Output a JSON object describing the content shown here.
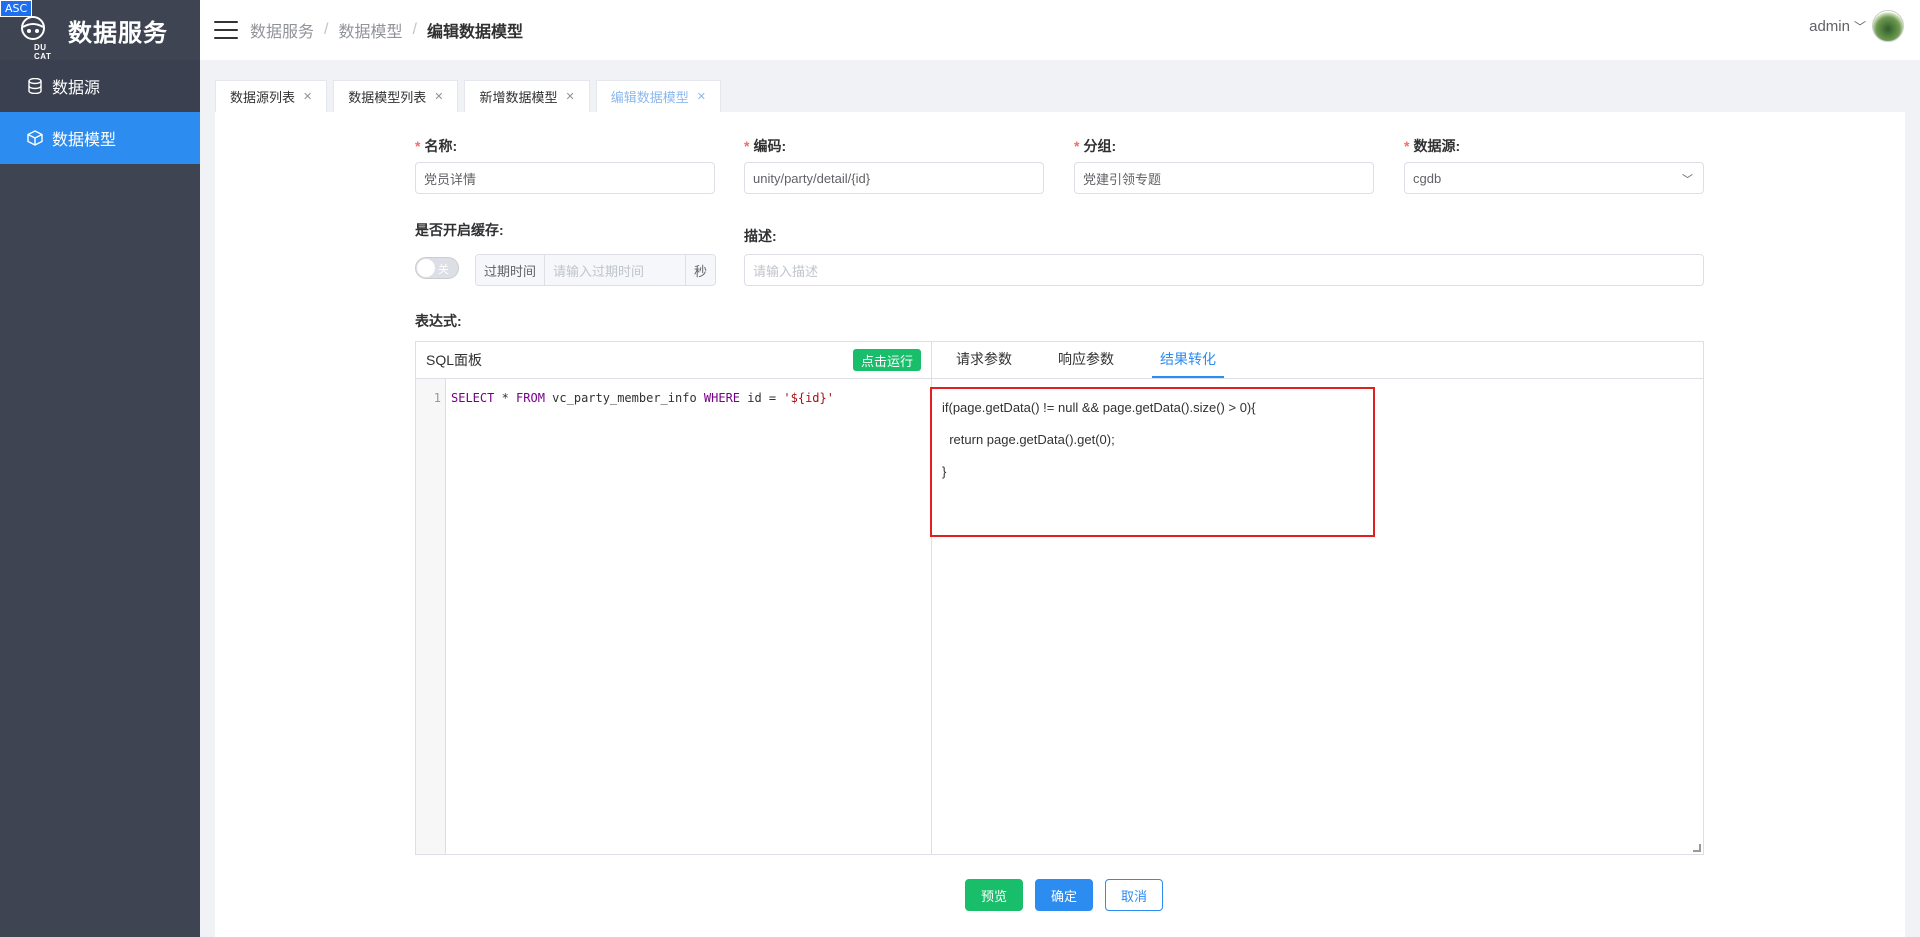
{
  "brand": {
    "badge": "ASC",
    "logo_sub": "DU CAT",
    "title": "数据服务"
  },
  "sidebar": {
    "items": [
      {
        "label": "数据源",
        "icon": "database-icon",
        "active": false
      },
      {
        "label": "数据模型",
        "icon": "cube-icon",
        "active": true
      }
    ]
  },
  "header": {
    "breadcrumb": [
      "数据服务",
      "数据模型",
      "编辑数据模型"
    ],
    "user": "admin"
  },
  "tabs": [
    {
      "label": "数据源列表",
      "active": false
    },
    {
      "label": "数据模型列表",
      "active": false
    },
    {
      "label": "新增数据模型",
      "active": false
    },
    {
      "label": "编辑数据模型",
      "active": true
    }
  ],
  "form": {
    "name_label": "名称:",
    "name_value": "党员详情",
    "code_label": "编码:",
    "code_value": "unity/party/detail/{id}",
    "group_label": "分组:",
    "group_value": "党建引领专题",
    "datasource_label": "数据源:",
    "datasource_value": "cgdb",
    "cache_label": "是否开启缓存:",
    "cache_switch_text": "关",
    "expire_prepend": "过期时间",
    "expire_placeholder": "请输入过期时间",
    "expire_append": "秒",
    "desc_label": "描述:",
    "desc_placeholder": "请输入描述",
    "expr_label": "表达式:"
  },
  "sql_panel": {
    "title": "SQL面板",
    "run_label": "点击运行",
    "line_number": "1",
    "code": {
      "kw1": "SELECT",
      "t1": " * ",
      "kw2": "FROM",
      "t2": " vc_party_member_info ",
      "kw3": "WHERE",
      "t3": " id = ",
      "s1": "'${id}'"
    }
  },
  "right_panel": {
    "tabs": [
      "请求参数",
      "响应参数",
      "结果转化"
    ],
    "active_tab": "结果转化",
    "script": "if(page.getData() != null && page.getData().size() > 0){\n  return page.getData().get(0);\n}"
  },
  "buttons": {
    "preview": "预览",
    "ok": "确定",
    "cancel": "取消"
  },
  "colors": {
    "primary": "#2d8cf0",
    "success": "#19be6b",
    "sidebar": "#3e4452",
    "highlight": "#e02020"
  }
}
